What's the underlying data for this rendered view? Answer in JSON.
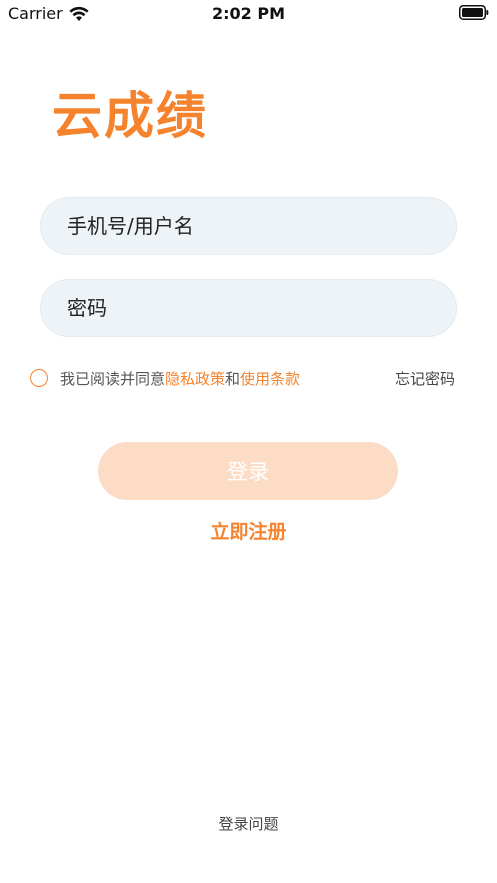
{
  "status_bar": {
    "carrier": "Carrier",
    "time": "2:02 PM"
  },
  "logo": {
    "text": "云成绩"
  },
  "form": {
    "username_placeholder": "手机号/用户名",
    "password_placeholder": "密码"
  },
  "agreement": {
    "prefix": "我已阅读并同意",
    "privacy_link": "隐私政策",
    "conjunction": "和",
    "terms_link": "使用条款",
    "checked": false
  },
  "forgot_password": "忘记密码",
  "login_button": "登录",
  "register_link": "立即注册",
  "login_problem": "登录问题",
  "colors": {
    "accent": "#f5832d",
    "button_disabled": "#fddcc6",
    "field_bg": "#edf3f6"
  },
  "icons": {
    "wifi": "wifi-icon",
    "battery": "battery-icon",
    "checkbox": "checkbox-circle-icon"
  }
}
